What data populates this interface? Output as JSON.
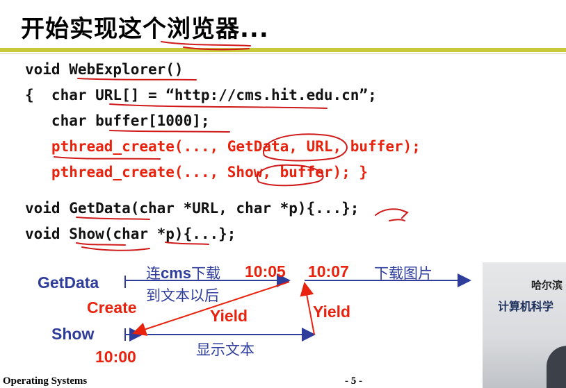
{
  "slide": {
    "title": "开始实现这个浏览器...",
    "code_lines": [
      "void WebExplorer()",
      "{  char URL[] = “http://cms.hit.edu.cn”;",
      "   char buffer[1000];",
      "   pthread_create(..., GetData, URL, buffer);",
      "   pthread_create(..., Show, buffer); }",
      "void GetData(char *URL, char *p){...};",
      "void Show(char *p){...};"
    ],
    "code_line_colors": [
      "#111111",
      "#111111",
      "#111111",
      "#e8220c",
      "#e8220c",
      "#111111",
      "#111111"
    ],
    "code_line4_tail": "}",
    "diagram": {
      "getdata_label": "GetData",
      "show_label": "Show",
      "create_label": "Create",
      "yield_label_1": "Yield",
      "yield_label_2": "Yield",
      "time_1005": "10:05",
      "time_1007": "10:07",
      "time_1000": "10:00",
      "cms_prefix": "连",
      "cms_bold": "cms",
      "cms_suffix": "下载",
      "download_images": "下载图片",
      "to_text_after": "到文本以后",
      "show_text": "显示文本"
    },
    "footer": {
      "course": "Operating Systems",
      "page": "- 5 -"
    },
    "photo": {
      "sign_line1": "哈尔滨",
      "sign_line2": "计算机科学"
    },
    "colors": {
      "accent_rule": "#c8c838",
      "red": "#e8220c",
      "blue": "#2e3c9c"
    }
  }
}
